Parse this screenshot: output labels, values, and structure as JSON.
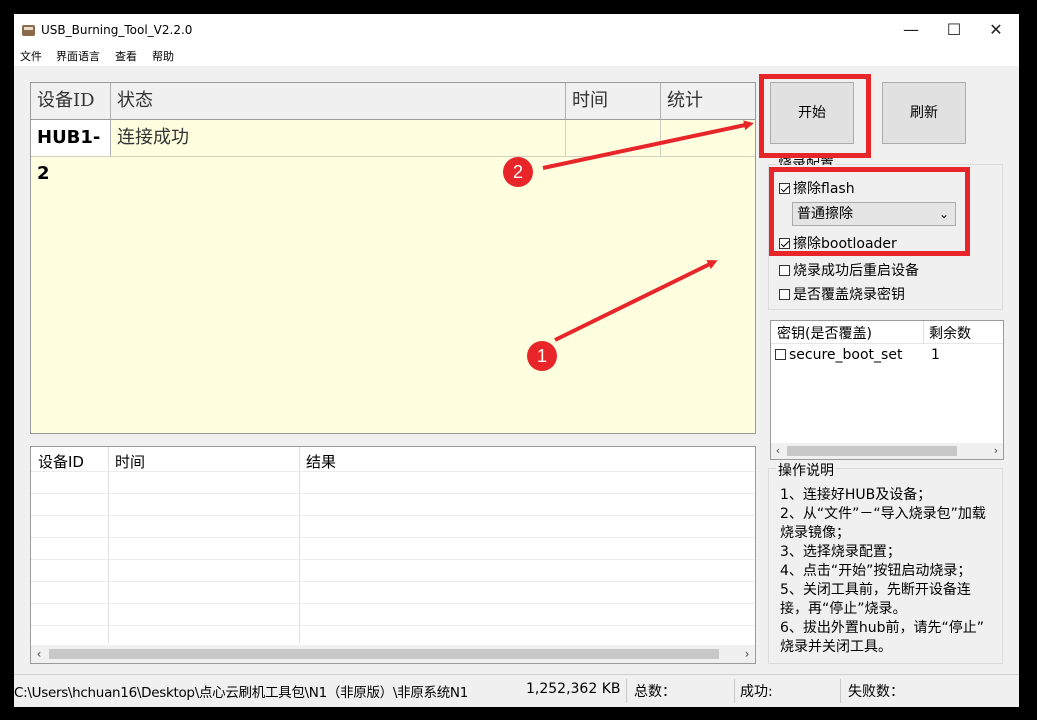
{
  "window": {
    "title": "USB_Burning_Tool_V2.2.0",
    "controls": {
      "minimize": "—",
      "maximize": "☐",
      "close": "✕"
    }
  },
  "menu": [
    "文件",
    "界面语言",
    "查看",
    "帮助"
  ],
  "device_table": {
    "headers": [
      "设备ID",
      "状态",
      "时间",
      "统计"
    ],
    "rows": [
      {
        "id": "HUB1-2",
        "status": "连接成功",
        "time": "",
        "stats": ""
      }
    ],
    "background": "#ffffe0"
  },
  "log_table": {
    "headers": [
      "设备ID",
      "时间",
      "结果"
    ],
    "scroll_left": "‹",
    "scroll_right": "›"
  },
  "buttons": {
    "start": "开始",
    "refresh": "刷新"
  },
  "config": {
    "title": "烧录配置",
    "erase_flash": {
      "label": "擦除flash",
      "checked": true
    },
    "erase_mode": {
      "value": "普通擦除",
      "chevron": "⌄"
    },
    "erase_bootloader": {
      "label": "擦除bootloader",
      "checked": true
    },
    "reboot_after": {
      "label": "烧录成功后重启设备",
      "checked": false
    },
    "overwrite_key": {
      "label": "是否覆盖烧录密钥",
      "checked": false
    }
  },
  "key_list": {
    "headers": [
      "密钥(是否覆盖)",
      "剩余数"
    ],
    "rows": [
      {
        "name": "secure_boot_set",
        "remaining": "1",
        "checked": false
      }
    ],
    "scroll_left": "‹",
    "scroll_right": "›"
  },
  "instructions": {
    "title": "操作说明",
    "lines": [
      "1、连接好HUB及设备；",
      "2、从“文件”－“导入烧录包”加载",
      "烧录镜像；",
      "3、选择烧录配置；",
      "4、点击“开始”按钮启动烧录；",
      "5、关闭工具前，先断开设备连",
      "接，再“停止”烧录。",
      "6、拔出外置hub前，请先“停止”",
      "烧录并关闭工具。"
    ]
  },
  "status_bar": {
    "path": "C:\\Users\\hchuan16\\Desktop\\点心云刷机工具包\\N1（非原版）\\非原系统N1",
    "size": "1,252,362 KB",
    "total": "总数：",
    "success": "成功:",
    "fail": "失败数："
  },
  "annotations": {
    "badge1": "1",
    "badge2": "2",
    "color": "#e8262a"
  }
}
